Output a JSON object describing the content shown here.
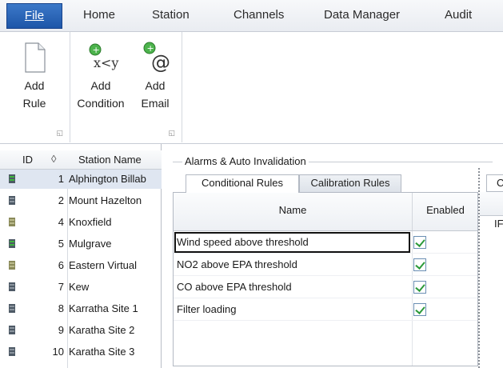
{
  "ribbon_tabs": {
    "file": "File",
    "home": "Home",
    "station": "Station",
    "channels": "Channels",
    "data_manager": "Data Manager",
    "audit": "Audit"
  },
  "ribbon": {
    "add_rule": "Add\nRule",
    "add_condition": "Add\nCondition",
    "add_email": "Add\nEmail",
    "condition_glyph": "x<y",
    "email_glyph": "@"
  },
  "station_table": {
    "col_id": "ID",
    "col_sort": "◊",
    "col_name": "Station Name",
    "rows": [
      {
        "id": "1",
        "name": "Alphington Billab",
        "icon": "green-station-icon"
      },
      {
        "id": "2",
        "name": "Mount Hazelton",
        "icon": "station-icon"
      },
      {
        "id": "4",
        "name": "Knoxfield",
        "icon": "virtual-station-icon"
      },
      {
        "id": "5",
        "name": "Mulgrave",
        "icon": "green-station-icon"
      },
      {
        "id": "6",
        "name": "Eastern Virtual",
        "icon": "virtual-station-icon"
      },
      {
        "id": "7",
        "name": "Kew",
        "icon": "station-icon"
      },
      {
        "id": "8",
        "name": "Karratha Site 1",
        "icon": "station-icon"
      },
      {
        "id": "9",
        "name": "Karatha Site 2",
        "icon": "station-icon"
      },
      {
        "id": "10",
        "name": "Karatha Site 3",
        "icon": "station-icon"
      }
    ]
  },
  "alarms": {
    "group_title": "Alarms & Auto Invalidation",
    "tab_conditional": "Conditional Rules",
    "tab_calibration": "Calibration Rules",
    "col_name": "Name",
    "col_enabled": "Enabled",
    "rules": [
      {
        "name": "Wind speed above threshold",
        "enabled": true
      },
      {
        "name": "NO2 above EPA threshold",
        "enabled": true
      },
      {
        "name": "CO above EPA threshold",
        "enabled": true
      },
      {
        "name": "Filter loading",
        "enabled": true
      }
    ]
  },
  "right_pane": {
    "tab_partial": "C",
    "cell_partial": "IF"
  },
  "colors": {
    "file_tab": "#2563b0",
    "selected_row": "#dfe6f1",
    "check": "#2c9a3a"
  }
}
